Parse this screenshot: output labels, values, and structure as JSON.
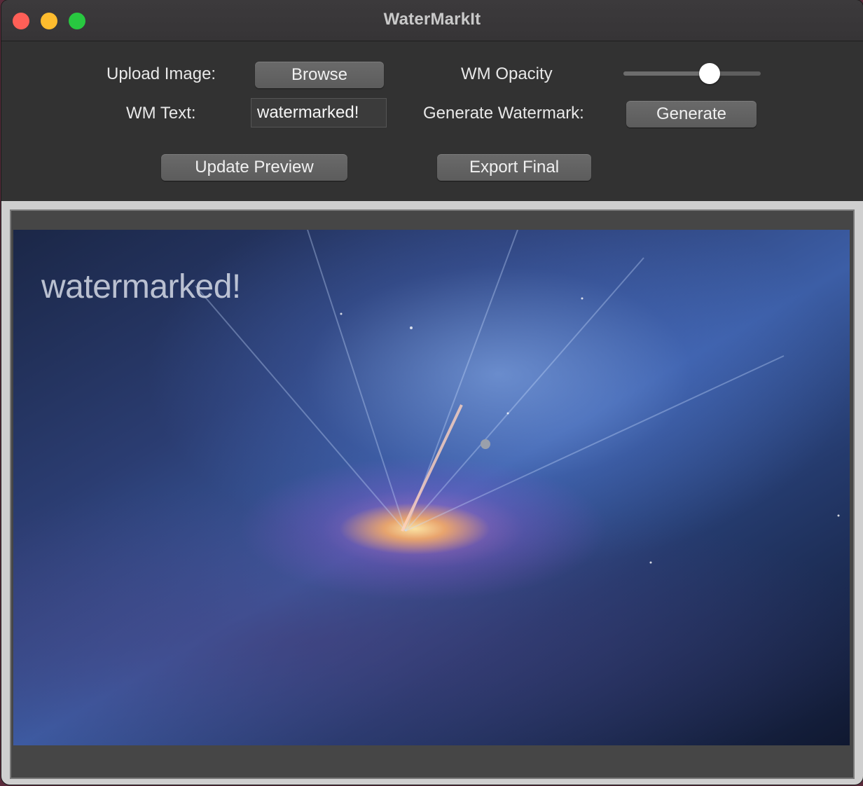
{
  "window": {
    "title": "WaterMarkIt"
  },
  "controls": {
    "upload_label": "Upload Image:",
    "browse_label": "Browse",
    "opacity_label": "WM Opacity",
    "opacity_value": 0.63,
    "wm_text_label": "WM Text:",
    "wm_text_value": "watermarked!",
    "generate_label": "Generate Watermark:",
    "generate_button": "Generate",
    "update_preview_button": "Update Preview",
    "export_button": "Export Final"
  },
  "preview": {
    "watermark_text": "watermarked!"
  },
  "colors": {
    "close": "#fe5f57",
    "minimize": "#febc2e",
    "maximize": "#28c840",
    "window_bg": "#333333"
  }
}
